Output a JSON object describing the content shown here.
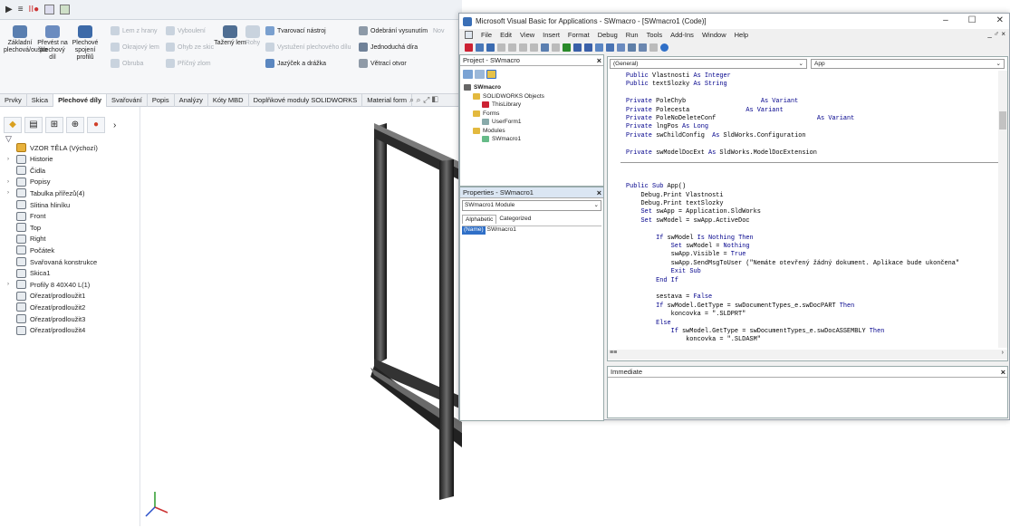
{
  "solidworks": {
    "ribbon": {
      "big": [
        {
          "label": "Základní plechová/ouško",
          "color": "#5a7fb0"
        },
        {
          "label": "Převést na plechový díl",
          "color": "#6b8cc0"
        },
        {
          "label": "Plechové spojení profilů",
          "color": "#3d6aa8"
        },
        {
          "label": "Tažený lem",
          "color": "#4f6e93"
        }
      ],
      "small_left": [
        {
          "label": "Lem z hrany",
          "disabled": true
        },
        {
          "label": "Okrajový lem",
          "disabled": true
        },
        {
          "label": "Obruba",
          "disabled": true
        }
      ],
      "small_mid": [
        {
          "label": "Vyboulení",
          "disabled": true
        },
        {
          "label": "Ohyb ze skic",
          "disabled": true
        },
        {
          "label": "Příčný zlom",
          "disabled": true
        }
      ],
      "rohy": "Rohy",
      "small_right": [
        {
          "label": "Tvarovací nástroj",
          "disabled": false
        },
        {
          "label": "Vystužení plechového dílu",
          "disabled": true
        },
        {
          "label": "Jazýček a drážka",
          "disabled": false
        }
      ],
      "small_far": [
        {
          "label": "Odebrání vysunutím",
          "disabled": false
        },
        {
          "label": "Jednoduchá díra",
          "disabled": false
        },
        {
          "label": "Větrací otvor",
          "disabled": false
        }
      ],
      "cut": "Nov"
    },
    "tabs": [
      "Prvky",
      "Skica",
      "Plechové díly",
      "Svařování",
      "Popis",
      "Analýzy",
      "Kóty MBD",
      "Doplňkové moduly SOLIDWORKS",
      "Material form"
    ],
    "active_tab": "Plechové díly",
    "tree": [
      {
        "label": "VZOR TĚLA  (Výchozí)",
        "arrow": ""
      },
      {
        "label": "Historie",
        "arrow": "›"
      },
      {
        "label": "Čidla",
        "arrow": ""
      },
      {
        "label": "Popisy",
        "arrow": "›"
      },
      {
        "label": "Tabulka přířezů(4)",
        "arrow": "›"
      },
      {
        "label": "Slitina hliníku",
        "arrow": ""
      },
      {
        "label": "Front",
        "arrow": ""
      },
      {
        "label": "Top",
        "arrow": ""
      },
      {
        "label": "Right",
        "arrow": ""
      },
      {
        "label": "Počátek",
        "arrow": ""
      },
      {
        "label": "Svařovaná konstrukce",
        "arrow": ""
      },
      {
        "label": "Skica1",
        "arrow": ""
      },
      {
        "label": "Profily 8 40X40 L(1)",
        "arrow": "›"
      },
      {
        "label": "Ořezat/prodloužit1",
        "arrow": ""
      },
      {
        "label": "Ořezat/prodloužit2",
        "arrow": ""
      },
      {
        "label": "Ořezat/prodloužit3",
        "arrow": ""
      },
      {
        "label": "Ořezat/prodloužit4",
        "arrow": ""
      }
    ]
  },
  "vba": {
    "title": "Microsoft Visual Basic for Applications - SWmacro - [SWmacro1 (Code)]",
    "menu": [
      "File",
      "Edit",
      "View",
      "Insert",
      "Format",
      "Debug",
      "Run",
      "Tools",
      "Add-Ins",
      "Window",
      "Help"
    ],
    "mdi": "_ ♂ ×",
    "project": {
      "header": "Project - SWmacro",
      "items": [
        {
          "label": "SWmacro",
          "bold": true
        },
        {
          "label": "SOLIDWORKS Objects",
          "bold": false
        },
        {
          "label": "ThisLibrary",
          "bold": false
        },
        {
          "label": "Forms",
          "bold": false
        },
        {
          "label": "UserForm1",
          "bold": false
        },
        {
          "label": "Modules",
          "bold": false
        },
        {
          "label": "SWmacro1",
          "bold": false
        }
      ]
    },
    "properties": {
      "header": "Properties - SWmacro1",
      "object": "SWmacro1 Module",
      "tabs": [
        "Alphabetic",
        "Categorized"
      ],
      "row_name": "(Name)",
      "row_value": "SWmacro1"
    },
    "code": {
      "object_combo": "(General)",
      "proc_combo": "App",
      "lines": [
        "Public Vlastnosti As Integer",
        "Public textSlozky As String",
        "",
        "Private PoleChyb                    As Variant",
        "Private Polecesta               As Variant",
        "Private PoleNoDeleteConf                           As Variant",
        "Private lngPos As Long",
        "Private swChildConfig  As SldWorks.Configuration",
        "",
        "Private swModelDocExt As SldWorks.ModelDocExtension",
        "",
        "",
        "",
        "Public Sub App()",
        "    Debug.Print Vlastnosti",
        "    Debug.Print textSlozky",
        "    Set swApp = Application.SldWorks",
        "    Set swModel = swApp.ActiveDoc",
        "",
        "        If swModel Is Nothing Then",
        "            Set swModel = Nothing",
        "            swApp.Visible = True",
        "            swApp.SendMsgToUser (\"Nemáte otevřený žádný dokument. Aplikace bude ukončena\"",
        "            Exit Sub",
        "        End If",
        "",
        "        sestava = False",
        "        If swModel.GetType = swDocumentTypes_e.swDocPART Then",
        "            koncovka = \".SLDPRT\"",
        "        Else",
        "            If swModel.GetType = swDocumentTypes_e.swDocASSEMBLY Then",
        "                koncovka = \".SLDASM\""
      ]
    },
    "immediate": "Immediate"
  }
}
